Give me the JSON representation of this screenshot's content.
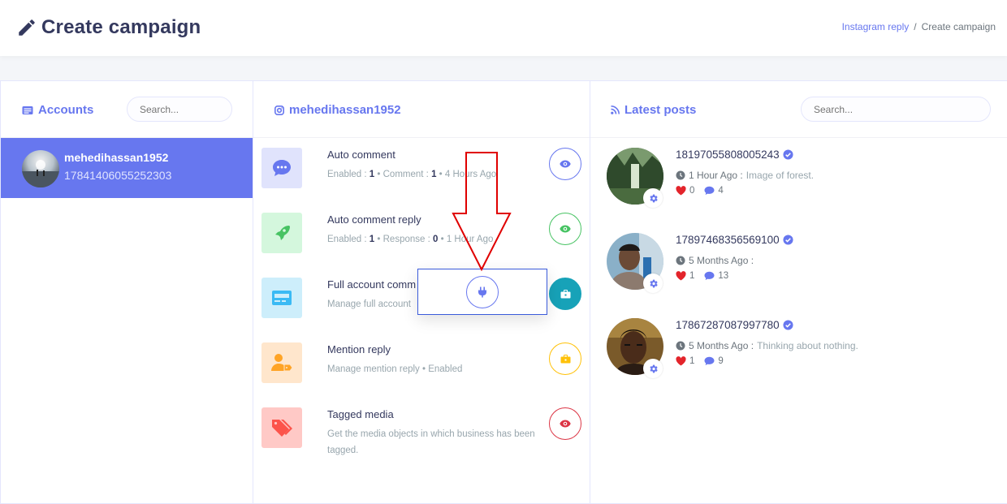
{
  "header": {
    "title": "Create campaign",
    "breadcrumb": {
      "link": "Instagram reply",
      "separator": "/",
      "current": "Create campaign"
    }
  },
  "accounts": {
    "title": "Accounts",
    "search_placeholder": "Search...",
    "items": [
      {
        "name": "mehedihassan1952",
        "id": "17841406055252303",
        "selected": true
      }
    ]
  },
  "center": {
    "title": "mehedihassan1952",
    "features": [
      {
        "title": "Auto comment",
        "meta": [
          "Enabled : ",
          "1",
          " • Comment : ",
          "1",
          " • 4 Hours Ago"
        ],
        "color": "#6777ef",
        "icon": "chat-bubble-icon",
        "action_icon": "eye-icon"
      },
      {
        "title": "Auto comment reply",
        "meta": [
          "Enabled : ",
          "1",
          " • Response : ",
          "0",
          " • 1 Hour Ago"
        ],
        "color": "#47c363",
        "icon": "rocket-icon",
        "action_icon": "eye-icon"
      },
      {
        "title": "Full account comm",
        "meta_text": "Manage full account",
        "color": "#3abaf4",
        "icon": "card-icon",
        "action_icon": "briefcase-icon"
      },
      {
        "title": "Mention reply",
        "meta_text": "Manage mention reply  •  Enabled",
        "color": "#ffa426",
        "icon": "user-tag-icon",
        "action_icon": "briefcase-icon"
      },
      {
        "title": "Tagged media",
        "meta_text": "Get the media objects in which business has been tagged.",
        "color": "#fc544b",
        "icon": "tags-icon",
        "action_icon": "eye-icon"
      }
    ],
    "popup_icon": "plug-icon"
  },
  "posts": {
    "title": "Latest posts",
    "search_placeholder": "Search...",
    "items": [
      {
        "id": "18197055808005243",
        "time": "1 Hour Ago :",
        "caption": "Image of forest.",
        "likes": "0",
        "comments": "4"
      },
      {
        "id": "17897468356569100",
        "time": "5 Months Ago :",
        "caption": "",
        "likes": "1",
        "comments": "13"
      },
      {
        "id": "17867287087997780",
        "time": "5 Months Ago :",
        "caption": "Thinking about nothing.",
        "likes": "1",
        "comments": "9"
      }
    ]
  },
  "colors": {
    "primary": "#6777ef",
    "success": "#47c363",
    "info": "#17a2b8",
    "warning": "#ffc107",
    "danger": "#dc3545",
    "arrow": "#e00000"
  }
}
